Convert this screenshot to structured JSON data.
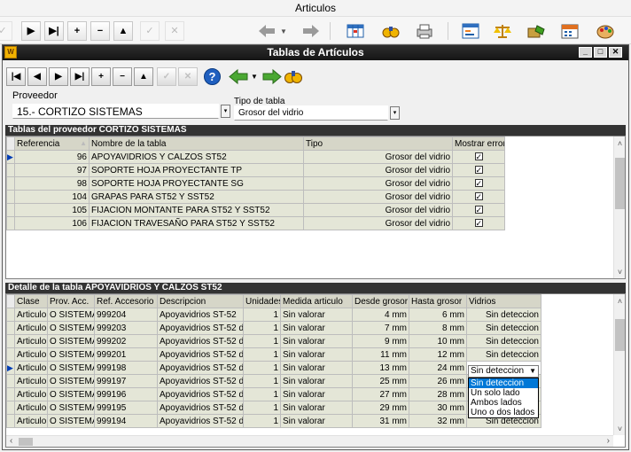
{
  "window": {
    "title": "Articulos"
  },
  "inner": {
    "title": "Tablas de Artículos"
  },
  "form": {
    "proveedor_label": "Proveedor",
    "proveedor_value": "15.- CORTIZO SISTEMAS",
    "tipo_label": "Tipo de tabla",
    "tipo_value": "Grosor del vidrio"
  },
  "tablas": {
    "header": "Tablas del proveedor CORTIZO SISTEMAS",
    "columns": [
      "Referencia",
      "Nombre de la tabla",
      "Tipo",
      "Mostrar error"
    ],
    "rows": [
      {
        "ref": "96",
        "nombre": "APOYAVIDRIOS Y CALZOS ST52",
        "tipo": "Grosor del vidrio",
        "mostrar": "✓"
      },
      {
        "ref": "97",
        "nombre": "SOPORTE HOJA PROYECTANTE TP",
        "tipo": "Grosor del vidrio",
        "mostrar": "✓"
      },
      {
        "ref": "98",
        "nombre": "SOPORTE HOJA PROYECTANTE SG",
        "tipo": "Grosor del vidrio",
        "mostrar": "✓"
      },
      {
        "ref": "104",
        "nombre": "GRAPAS PARA ST52 Y SST52",
        "tipo": "Grosor del vidrio",
        "mostrar": "✓"
      },
      {
        "ref": "105",
        "nombre": "FIJACION MONTANTE PARA ST52 Y SST52",
        "tipo": "Grosor del vidrio",
        "mostrar": "✓"
      },
      {
        "ref": "106",
        "nombre": "FIJACION TRAVESAÑO PARA ST52 Y SST52",
        "tipo": "Grosor del vidrio",
        "mostrar": "✓"
      }
    ]
  },
  "detalle": {
    "header": "Detalle de la tabla  APOYAVIDRIOS Y CALZOS ST52",
    "columns": [
      "Clase",
      "Prov. Acc.",
      "Ref. Accesorio",
      "Descripcion",
      "Unidades",
      "Medida articulo",
      "Desde grosor",
      "Hasta grosor",
      "Vidrios"
    ],
    "rows": [
      {
        "clase": "Articulo",
        "prov": "O SISTEMAS",
        "ref": "999204",
        "desc": "Apoyavidrios ST-52",
        "uds": "1",
        "medida": "Sin valorar",
        "desde": "4 mm",
        "hasta": "6 mm",
        "vidrios": "Sin deteccion"
      },
      {
        "clase": "Articulo",
        "prov": "O SISTEMAS",
        "ref": "999203",
        "desc": "Apoyavidrios ST-52 de 1",
        "uds": "1",
        "medida": "Sin valorar",
        "desde": "7 mm",
        "hasta": "8 mm",
        "vidrios": "Sin deteccion"
      },
      {
        "clase": "Articulo",
        "prov": "O SISTEMAS",
        "ref": "999202",
        "desc": "Apoyavidrios ST-52 de 2",
        "uds": "1",
        "medida": "Sin valorar",
        "desde": "9 mm",
        "hasta": "10 mm",
        "vidrios": "Sin deteccion"
      },
      {
        "clase": "Articulo",
        "prov": "O SISTEMAS",
        "ref": "999201",
        "desc": "Apoyavidrios ST-52 de 2",
        "uds": "1",
        "medida": "Sin valorar",
        "desde": "11 mm",
        "hasta": "12 mm",
        "vidrios": "Sin deteccion"
      },
      {
        "clase": "Articulo",
        "prov": "O SISTEMAS",
        "ref": "999198",
        "desc": "Apoyavidrios ST-52 de 3",
        "uds": "1",
        "medida": "Sin valorar",
        "desde": "13 mm",
        "hasta": "24 mm",
        "vidrios": "Sin deteccion"
      },
      {
        "clase": "Articulo",
        "prov": "O SISTEMAS",
        "ref": "999197",
        "desc": "Apoyavidrios ST-52 de 3",
        "uds": "1",
        "medida": "Sin valorar",
        "desde": "25 mm",
        "hasta": "26 mm",
        "vidrios": ""
      },
      {
        "clase": "Articulo",
        "prov": "O SISTEMAS",
        "ref": "999196",
        "desc": "Apoyavidrios ST-52 de 3",
        "uds": "1",
        "medida": "Sin valorar",
        "desde": "27 mm",
        "hasta": "28 mm",
        "vidrios": ""
      },
      {
        "clase": "Articulo",
        "prov": "O SISTEMAS",
        "ref": "999195",
        "desc": "Apoyavidrios ST-52 de 3",
        "uds": "1",
        "medida": "Sin valorar",
        "desde": "29 mm",
        "hasta": "30 mm",
        "vidrios": ""
      },
      {
        "clase": "Articulo",
        "prov": "O SISTEMAS",
        "ref": "999194",
        "desc": "Apoyavidrios ST-52 de 4",
        "uds": "1",
        "medida": "Sin valorar",
        "desde": "31 mm",
        "hasta": "32 mm",
        "vidrios": "Sin deteccion"
      }
    ],
    "dropdown": {
      "value": "Sin deteccion",
      "options": [
        "Sin deteccion",
        "Un solo lado",
        "Ambos lados",
        "Uno o dos lados"
      ]
    }
  }
}
